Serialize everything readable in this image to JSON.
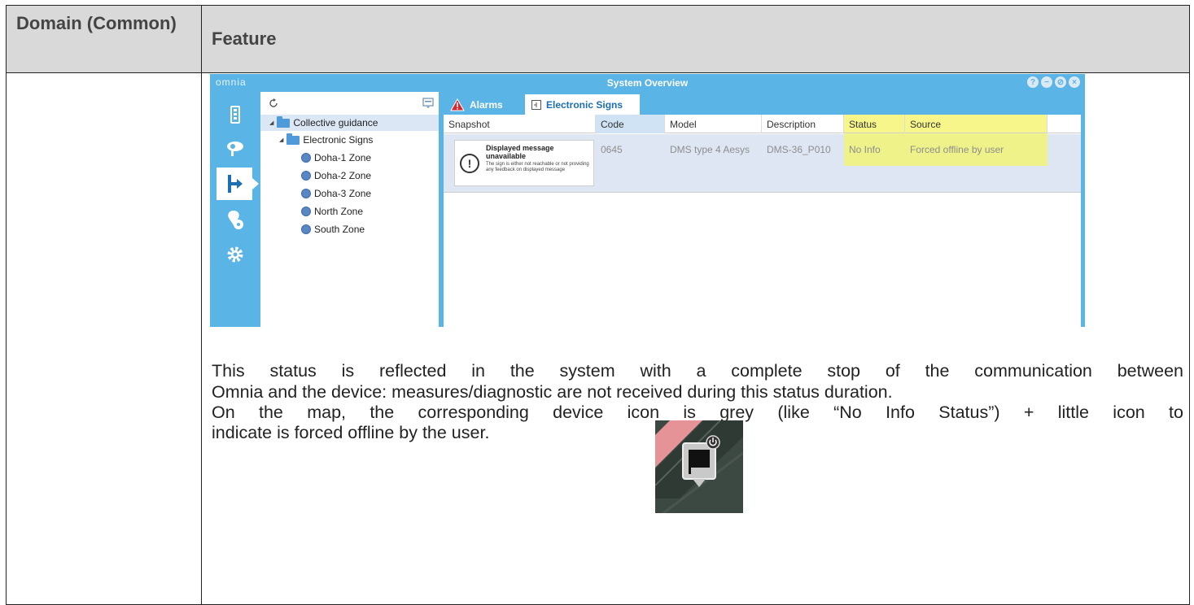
{
  "header": {
    "domain_label": "Domain (Common)",
    "feature_label": "Feature"
  },
  "app": {
    "logo": "omnia",
    "title": "System Overview",
    "window_buttons": [
      "?",
      "−",
      "⊘",
      "×"
    ],
    "nav_icons": [
      "traffic-light-icon",
      "camera-icon",
      "route-icon",
      "location-icon",
      "gear-icon"
    ],
    "tree": {
      "items": [
        {
          "label": "Collective guidance",
          "level": 0,
          "type": "folder"
        },
        {
          "label": "Electronic Signs",
          "level": 1,
          "type": "folder"
        },
        {
          "label": "Doha-1 Zone",
          "level": 2,
          "type": "zone"
        },
        {
          "label": "Doha-2 Zone",
          "level": 2,
          "type": "zone"
        },
        {
          "label": "Doha-3 Zone",
          "level": 2,
          "type": "zone"
        },
        {
          "label": "North Zone",
          "level": 2,
          "type": "zone"
        },
        {
          "label": "South Zone",
          "level": 2,
          "type": "zone"
        }
      ]
    },
    "tabs": {
      "alarms": "Alarms",
      "electronic_signs": "Electronic Signs"
    },
    "grid": {
      "columns": [
        "Snapshot",
        "Code",
        "Model",
        "Description",
        "Status",
        "Source"
      ],
      "row": {
        "snapshot_title": "Displayed message unavailable",
        "snapshot_sub": "The sign is either not reachable or not providing any feedback on displayed message",
        "code": "0645",
        "model": "DMS type 4 Aesys",
        "description": "DMS-36_P010",
        "status": "No Info",
        "source": "Forced offline by user"
      }
    }
  },
  "text": {
    "line1": "This status is reflected in the system with a complete stop of the communication between",
    "line2": "Omnia and the device: measures/diagnostic are not received during this status duration.",
    "line3": "On the map, the corresponding device icon is grey (like “No Info Status”) + little icon to",
    "line4": "indicate is forced offline by the user."
  },
  "colors": {
    "app_blue": "#5ab4e5",
    "highlight": "#f3f36a",
    "header_bg": "#d9d9d9"
  }
}
